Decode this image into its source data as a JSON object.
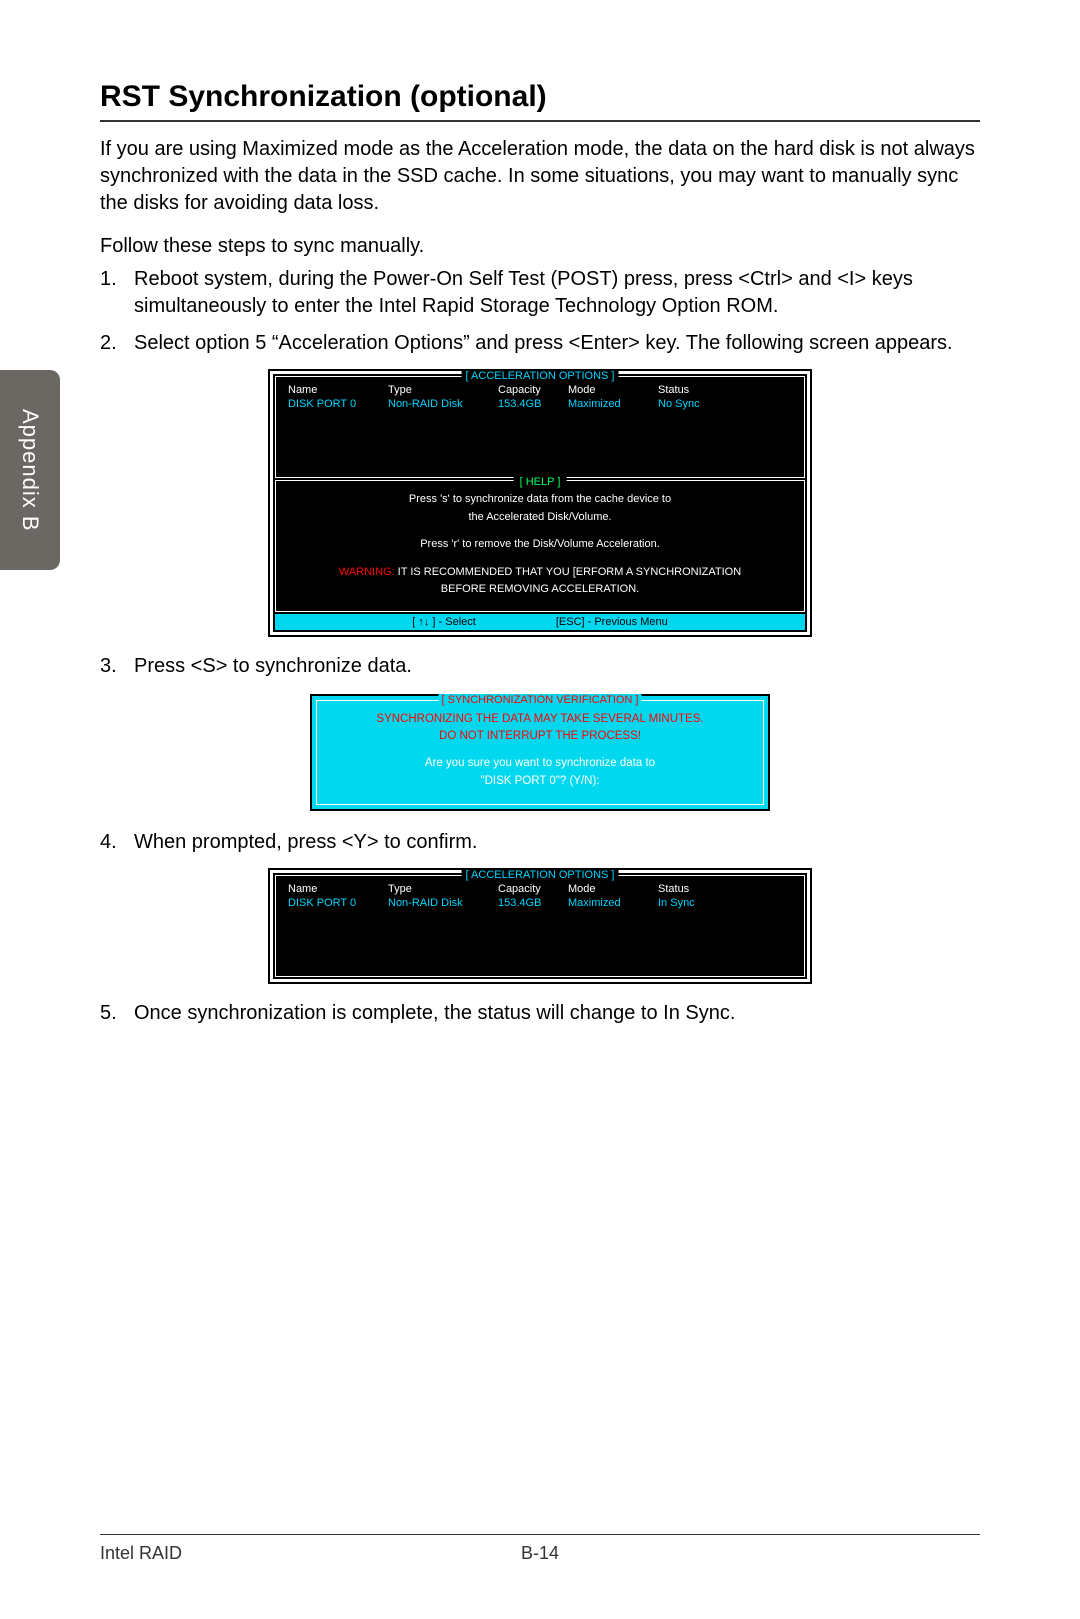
{
  "sidebar": {
    "label": "Appendix B"
  },
  "title": "RST Synchronization (optional)",
  "intro": "If you are using Maximized mode as the Acceleration mode, the data on the hard disk is not always synchronized with the data in the SSD cache. In some situations, you may want to manually sync the disks for avoiding data loss.",
  "follow": "Follow these steps to sync manually.",
  "steps": {
    "s1": "Reboot system, during the Power-On Self Test (POST) press, press <Ctrl> and <I> keys simultaneously to enter the Intel Rapid Storage Technology Option ROM.",
    "s2": "Select option 5 “Acceleration Options” and press <Enter> key. The following screen appears.",
    "s3": "Press <S> to synchronize data.",
    "s4": "When prompted, press <Y> to confirm.",
    "s5": "Once synchronization is complete, the status will change to In Sync."
  },
  "bios1": {
    "title": "[ ACCELERATION OPTIONS ]",
    "headers": {
      "name": "Name",
      "type": "Type",
      "cap": "Capacity",
      "mode": "Mode",
      "status": "Status"
    },
    "row": {
      "name": "DISK PORT 0",
      "type": "Non-RAID Disk",
      "cap": "153.4GB",
      "mode": "Maximized",
      "status": "No Sync"
    },
    "help_title": "[   HELP   ]",
    "help1": "Press 's' to synchronize data from the cache device to",
    "help1b": "the Accelerated Disk/Volume.",
    "help2": "Press 'r' to remove the Disk/Volume Acceleration.",
    "warn_label": "WARNING:",
    "warn_text": " IT IS RECOMMENDED THAT YOU [ERFORM A SYNCHRONIZATION",
    "warn_text2": "BEFORE REMOVING ACCELERATION.",
    "foot_left": "[ ↑↓ ] - Select",
    "foot_right": "[ESC] - Previous Menu"
  },
  "sync": {
    "title": "[ SYNCHRONIZATION VERIFICATION ]",
    "l1": "SYNCHRONIZING THE DATA MAY TAKE SEVERAL MINUTES.",
    "l2": "DO NOT INTERRUPT THE PROCESS!",
    "q1": "Are you sure you want to synchronize data to",
    "q2": "\"DISK PORT 0\"? (Y/N):"
  },
  "bios2": {
    "title": "[ ACCELERATION OPTIONS ]",
    "row": {
      "name": "DISK PORT 0",
      "type": "Non-RAID Disk",
      "cap": "153.4GB",
      "mode": "Maximized",
      "status": "In Sync"
    }
  },
  "footer": {
    "left": "Intel RAID",
    "center": "B-14"
  }
}
